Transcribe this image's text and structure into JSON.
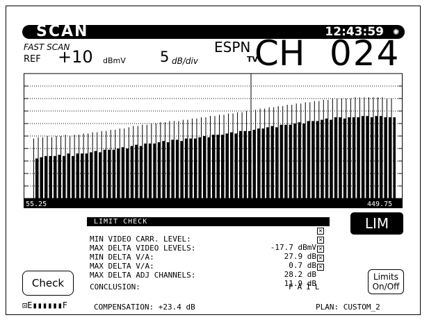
{
  "header": {
    "mode": "SCAN",
    "clock": "12:43:59"
  },
  "sub": {
    "scan_type": "FAST SCAN",
    "ref_label": "REF",
    "ref_value": "+10",
    "ref_unit": "dBmV",
    "scale_value": "5",
    "scale_unit": "dB/div",
    "network_line1": "ESPN",
    "network_line2": "TV",
    "channel_label": "CH",
    "channel_number": "024"
  },
  "spectrum": {
    "start_label": "55.25",
    "stop_label": "449.75",
    "divisions": 10,
    "ref_level": 10,
    "db_per_div": 5,
    "channel_marker_fraction": 0.6,
    "video_levels_div": [
      4.8,
      4.9,
      4.9,
      5.0,
      4.9,
      5.0,
      5.0,
      5.1,
      5.0,
      5.1,
      5.1,
      5.2,
      5.2,
      5.3,
      5.3,
      5.4,
      5.4,
      5.5,
      5.5,
      5.6,
      5.6,
      5.7,
      5.8,
      5.8,
      5.9,
      5.9,
      6.0,
      6.0,
      6.1,
      6.1,
      6.2,
      6.2,
      6.2,
      6.3,
      6.3,
      6.4,
      6.4,
      6.5,
      6.5,
      6.6,
      6.6,
      6.7,
      6.7,
      6.8,
      6.8,
      6.9,
      6.9,
      7.0,
      7.0,
      7.1,
      7.2,
      7.2,
      7.3,
      7.3,
      7.4,
      7.4,
      7.5,
      7.5,
      7.6,
      7.6,
      7.7,
      7.7,
      7.8,
      7.8,
      7.9,
      7.9,
      8.0,
      8.0,
      8.0,
      8.0,
      8.0,
      8.1,
      8.1,
      8.1,
      8.1,
      8.1,
      8.1,
      8.1,
      8.0,
      8.0
    ],
    "audio_offset_div": [
      1.6,
      1.6,
      1.5,
      1.6,
      1.5,
      1.5,
      1.6,
      1.5,
      1.6,
      1.5,
      1.5,
      1.6,
      1.5,
      1.5,
      1.6,
      1.5,
      1.5,
      1.6,
      1.5,
      1.5,
      1.6,
      1.5,
      1.5,
      1.6,
      1.5,
      1.5,
      1.6,
      1.5,
      1.5,
      1.6,
      1.5,
      1.5,
      1.6,
      1.5,
      1.5,
      1.6,
      1.5,
      1.5,
      1.6,
      1.5,
      1.5,
      1.6,
      1.5,
      1.5,
      1.6,
      1.5,
      1.5,
      1.6,
      1.5,
      1.5,
      1.6,
      1.5,
      1.5,
      1.6,
      1.5,
      1.5,
      1.6,
      1.5,
      1.5,
      1.6,
      1.5,
      1.5,
      1.6,
      1.5,
      1.5,
      1.6,
      1.5,
      1.5,
      1.6,
      1.5,
      1.5,
      1.6,
      1.5,
      1.5,
      1.6,
      1.5,
      1.5,
      1.6,
      1.5,
      1.5
    ]
  },
  "limit_check": {
    "title": "LIMIT CHECK",
    "rows": [
      {
        "label": "MIN VIDEO CARR. LEVEL:",
        "value": "-17.7 dBmV"
      },
      {
        "label": "MAX DELTA VIDEO LEVELS:",
        "value": "27.9 dB"
      },
      {
        "label": "MIN DELTA V/A:",
        "value": "0.7 dB"
      },
      {
        "label": "MAX DELTA V/A:",
        "value": "28.2 dB"
      },
      {
        "label": "MAX DELTA ADJ CHANNELS:",
        "value": "11.9 dB"
      }
    ],
    "conclusion_label": "CONCLUSION:",
    "conclusion_value": "FAIL"
  },
  "buttons": {
    "lim": "LIM",
    "check": "Check",
    "limits_line1": "Limits",
    "limits_line2": "On/Off"
  },
  "footer": {
    "battery_f": "F",
    "compensation": "COMPENSATION: +23.4 dB",
    "plan": "PLAN: CUSTOM_2"
  }
}
